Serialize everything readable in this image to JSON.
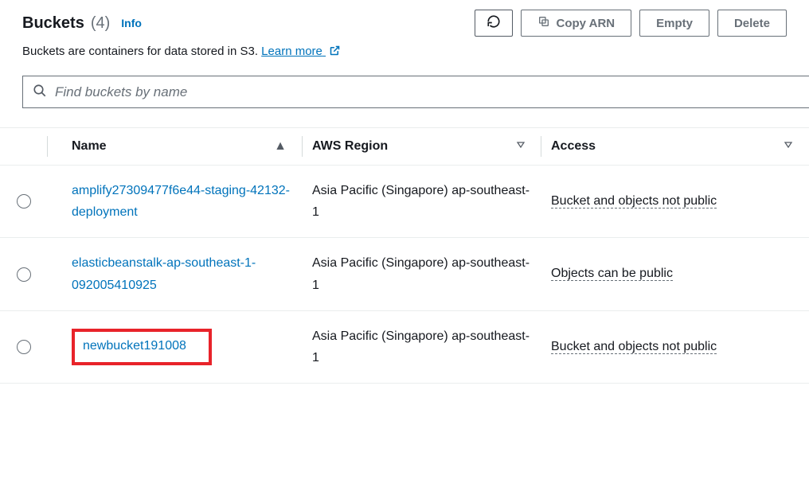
{
  "header": {
    "title": "Buckets",
    "count": "(4)",
    "info": "Info",
    "subtitle_prefix": "Buckets are containers for data stored in S3. ",
    "learn_more": "Learn more",
    "buttons": {
      "copy_arn": "Copy ARN",
      "empty": "Empty",
      "delete": "Delete"
    }
  },
  "search": {
    "placeholder": "Find buckets by name"
  },
  "table": {
    "headers": {
      "name": "Name",
      "region": "AWS Region",
      "access": "Access"
    },
    "rows": [
      {
        "name": "amplify27309477f6e44-staging-42132-deployment",
        "region": "Asia Pacific (Singapore) ap-southeast-1",
        "access": "Bucket and objects not public",
        "highlighted": false
      },
      {
        "name": "elasticbeanstalk-ap-southeast-1-092005410925",
        "region": "Asia Pacific (Singapore) ap-southeast-1",
        "access": "Objects can be public",
        "highlighted": false
      },
      {
        "name": "newbucket191008",
        "region": "Asia Pacific (Singapore) ap-southeast-1",
        "access": "Bucket and objects not public",
        "highlighted": true
      }
    ]
  }
}
